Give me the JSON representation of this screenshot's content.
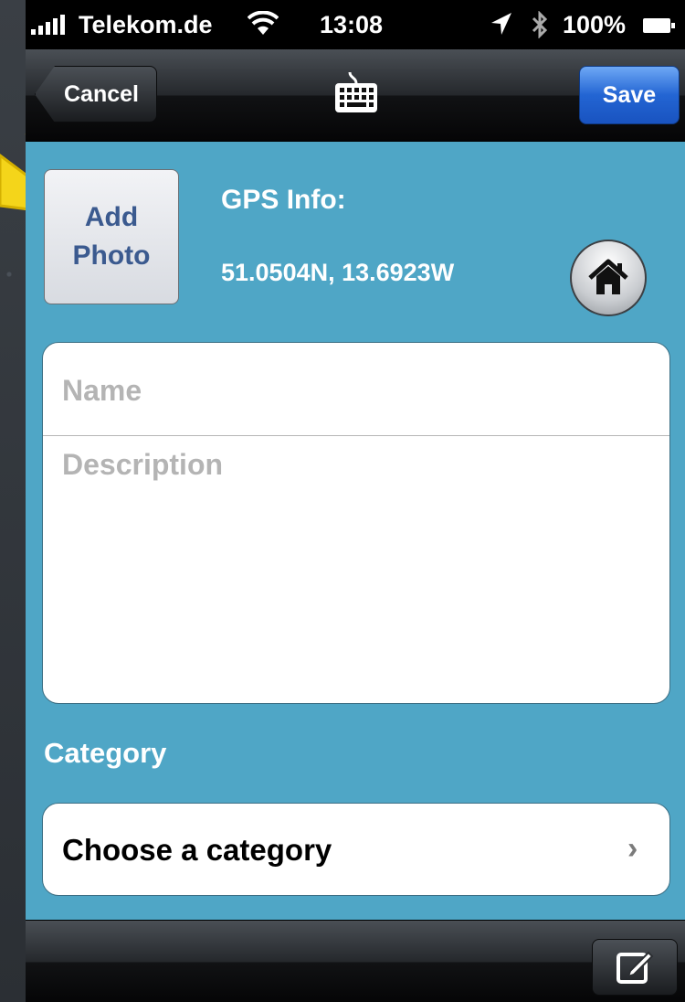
{
  "status_bar": {
    "carrier": "Telekom.de",
    "time": "13:08",
    "battery": "100%",
    "icons": [
      "signal-icon",
      "wifi-icon",
      "location-arrow-icon",
      "bluetooth-icon",
      "battery-icon"
    ]
  },
  "nav_bar": {
    "cancel_label": "Cancel",
    "save_label": "Save",
    "center_icon": "keyboard-icon",
    "save_color": "#2a6fe0"
  },
  "photo": {
    "add_label": "Add\nPhoto"
  },
  "gps": {
    "label": "GPS Info:",
    "value": "51.0504N, 13.6923W",
    "home_icon": "home-icon"
  },
  "form": {
    "name_placeholder": "Name",
    "description_placeholder": "Description"
  },
  "category": {
    "heading": "Category",
    "select_label": "Choose a category",
    "chevron": "›"
  },
  "toolbar": {
    "compose_icon": "compose-icon"
  },
  "colors": {
    "background": "#4fa6c6",
    "annotation": "#f4d51a"
  }
}
